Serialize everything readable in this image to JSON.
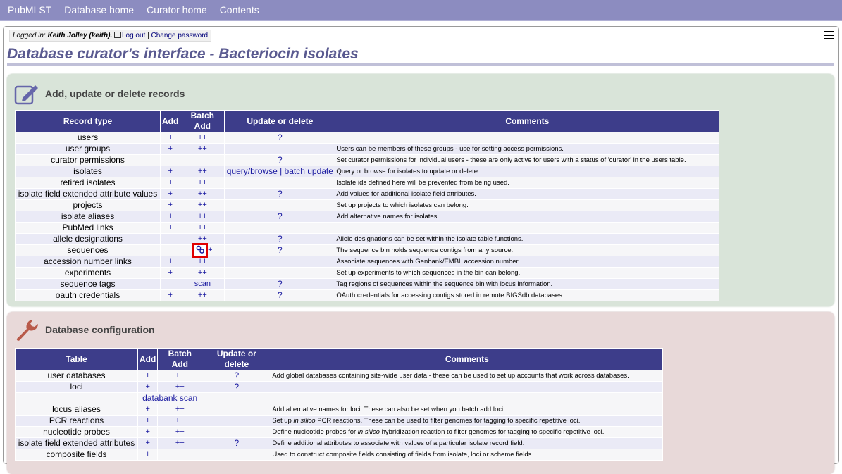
{
  "nav": [
    "PubMLST",
    "Database home",
    "Curator home",
    "Contents"
  ],
  "login": {
    "label": "Logged in:",
    "user": "Keith Jolley (keith).",
    "logout": "Log out",
    "sep": "|",
    "change_password": "Change password"
  },
  "page_title": "Database curator's interface - Bacteriocin isolates",
  "records_panel": {
    "heading": "Add, update or delete records",
    "headers": [
      "Record type",
      "Add",
      "Batch Add",
      "Update or delete",
      "Comments"
    ],
    "rows": [
      {
        "type": "users",
        "add": "+",
        "batch": "++",
        "update": "?",
        "comment": ""
      },
      {
        "type": "user groups",
        "add": "+",
        "batch": "++",
        "update": "",
        "comment": "Users can be members of these groups - use for setting access permissions."
      },
      {
        "type": "curator permissions",
        "add": "",
        "batch": "",
        "update": "?",
        "comment": "Set curator permissions for individual users - these are only active for users with a status of 'curator' in the users table."
      },
      {
        "type": "isolates",
        "add": "+",
        "batch": "++",
        "update": "query/browse | batch update",
        "comment": "Query or browse for isolates to update or delete."
      },
      {
        "type": "retired isolates",
        "add": "+",
        "batch": "++",
        "update": "",
        "comment": "Isolate ids defined here will be prevented from being used."
      },
      {
        "type": "isolate field extended attribute values",
        "add": "+",
        "batch": "++",
        "update": "?",
        "comment": "Add values for additional isolate field attributes."
      },
      {
        "type": "projects",
        "add": "+",
        "batch": "++",
        "update": "",
        "comment": "Set up projects to which isolates can belong."
      },
      {
        "type": "isolate aliases",
        "add": "+",
        "batch": "++",
        "update": "?",
        "comment": "Add alternative names for isolates."
      },
      {
        "type": "PubMed links",
        "add": "+",
        "batch": "++",
        "update": "",
        "comment": ""
      },
      {
        "type": "allele designations",
        "add": "",
        "batch": "++",
        "update": "?",
        "comment": "Allele designations can be set within the isolate table functions."
      },
      {
        "type": "sequences",
        "add": "",
        "batch": "+",
        "update": "?",
        "comment": "The sequence bin holds sequence contigs from any source."
      },
      {
        "type": "accession number links",
        "add": "+",
        "batch": "++",
        "update": "",
        "comment": "Associate sequences with Genbank/EMBL accession number."
      },
      {
        "type": "experiments",
        "add": "+",
        "batch": "++",
        "update": "",
        "comment": "Set up experiments to which sequences in the bin can belong."
      },
      {
        "type": "sequence tags",
        "add": "",
        "batch": "scan",
        "update": "?",
        "comment": "Tag regions of sequences within the sequence bin with locus information."
      },
      {
        "type": "oauth credentials",
        "add": "+",
        "batch": "++",
        "update": "?",
        "comment": "OAuth credentials for accessing contigs stored in remote BIGSdb databases."
      }
    ]
  },
  "config_panel": {
    "heading": "Database configuration",
    "headers": [
      "Table",
      "Add",
      "Batch Add",
      "Update or delete",
      "Comments"
    ],
    "rows": [
      {
        "type": "user databases",
        "add": "+",
        "batch": "++",
        "update": "?",
        "comment": "Add global databases containing site-wide user data - these can be used to set up accounts that work across databases."
      },
      {
        "type": "loci",
        "add": "+",
        "batch": "++",
        "update": "?",
        "comment": ""
      },
      {
        "type": "locus aliases",
        "add": "+",
        "batch": "++",
        "update": "",
        "comment": "Add alternative names for loci. These can also be set when you batch add loci."
      },
      {
        "type": "PCR reactions",
        "add": "+",
        "batch": "++",
        "update": "",
        "comment_pre": "Set up ",
        "comment_em": "in silico",
        "comment_post": " PCR reactions. These can be used to filter genomes for tagging to specific repetitive loci."
      },
      {
        "type": "nucleotide probes",
        "add": "+",
        "batch": "++",
        "update": "",
        "comment_pre": "Define nucleotide probes for ",
        "comment_em": "in silico",
        "comment_post": " hybridization reaction to filter genomes for tagging to specific repetitive loci."
      },
      {
        "type": "isolate field extended attributes",
        "add": "+",
        "batch": "++",
        "update": "?",
        "comment": "Define additional attributes to associate with values of a particular isolate record field."
      },
      {
        "type": "composite fields",
        "add": "+",
        "batch": "",
        "update": "",
        "comment": "Used to construct composite fields consisting of fields from isolate, loci or scheme fields."
      }
    ],
    "loci_extra": "databank scan"
  },
  "colors": {
    "nav_bg": "#8c8cc0",
    "table_header": "#3d3d8a",
    "green_panel": "#d9e4d9",
    "pink_panel": "#e8d9d9",
    "highlight": "#e00000"
  }
}
